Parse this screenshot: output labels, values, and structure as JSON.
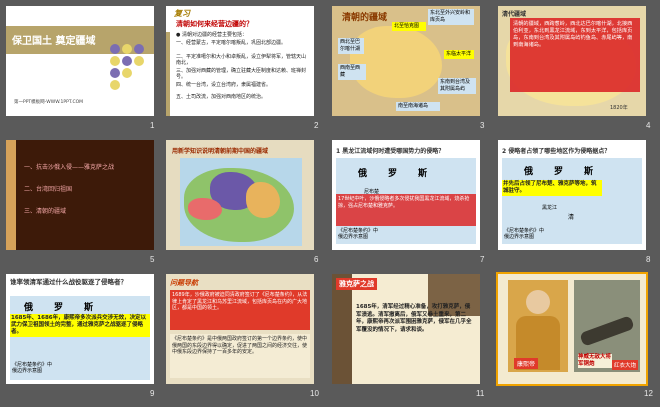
{
  "slides": [
    {
      "num": "1",
      "title": "保卫国土 奠定疆域",
      "footer": "第一PPT模板网-WWW.1PPT.COM"
    },
    {
      "num": "2",
      "tag": "复习",
      "title": "清朝如何来经营边疆的？",
      "lines": [
        "● 清朝对边疆的经营主要包括：",
        "一、经营蒙古，平定喀尔喀叛乱，巩固北部边疆。",
        "二、平定准噶尔和大小和卓叛乱，设立伊犁将军，管辖天山南北，",
        "三、加强对西藏的管理，确立驻藏大臣制度和达赖、班禅封号。",
        "四、统一台湾，设立台湾府，隶属福建省。",
        "五、土司改流，加强对西南地区的统治。"
      ]
    },
    {
      "num": "3",
      "title": "清朝的疆域",
      "labels": [
        "东北至外兴安岭和库页岛",
        "北至恰克图",
        "西北至巴尔喀什湖",
        "西南至西藏",
        "东临太平洋",
        "东南到台湾及其附属岛屿",
        "南至南海诸岛"
      ]
    },
    {
      "num": "4",
      "title": "清代疆域",
      "text": "清朝的疆域，西跨葱岭，西北达巴尔喀什湖，北接西伯利亚，东北到黑龙江流域，东到太平洋，包括库页岛，东南到台湾及其附属岛屿钓鱼岛、赤尾屿等，南到南海诸岛。",
      "caption": "1820年"
    },
    {
      "num": "5",
      "items": [
        "一、抗击沙俄入侵——雅克萨之战",
        "二、台湾回归祖国",
        "三、清朝的疆域"
      ]
    },
    {
      "num": "6",
      "title": "用新学知识说明清朝前期中国的疆域"
    },
    {
      "num": "7",
      "title": "1 黑龙江流域何时遭受哪国势力的侵略？",
      "map": [
        "俄",
        "罗",
        "斯",
        "尼布楚"
      ],
      "text": "17世纪中叶，沙俄侵略者多次侵扰我国黑龙江流域，烧杀抢掠，强占尼布楚和雅克萨。",
      "caption": "《尼布楚条约》中俄边界示意图"
    },
    {
      "num": "8",
      "title": "2 侵略者占领了哪些地区作为侵略据点？",
      "map": [
        "俄",
        "罗",
        "斯",
        "黑龙江",
        "清"
      ],
      "text": "并先后占领了尼布楚、雅克萨等地，筑城驻守。",
      "caption": "《尼布楚条约》中俄边界示意图"
    },
    {
      "num": "9",
      "title": "谁率领清军通过什么战役驱逐了侵略者？",
      "map": [
        "俄",
        "罗",
        "斯"
      ],
      "text": "1685年、1686年，康熙帝多次派兵交涉无效，决定以武力保卫祖国领土的完整，通过雅克萨之战驱逐了侵略者。",
      "caption": "《尼布楚条约》中俄边界示意图"
    },
    {
      "num": "10",
      "tag": "问题导航",
      "text1": "1689年，沙俄政府被迫同清政府签订了《尼布楚条约》，从法律上肯定了黑龙江和乌苏里江流域，包括库页岛在内的广大地区，都是中国的领土。",
      "text2": "《尼布楚条约》是中俄两国政府签订的第一个边界条约，使中俄两国的东段边界得以确定，促进了两国之间的经济交往，使中俄东段边界保持了一百多年的安定。"
    },
    {
      "num": "11",
      "tag": "雅克萨之战",
      "text": "1685年，清军经过精心准备，攻打雅克萨，俄军溃逃。清军撤离后，俄军又卷土重来，第二年，康熙帝再次派军围困雅克萨，俄军在几乎全军覆没的情况下，请求和谈。"
    },
    {
      "num": "12",
      "labels": [
        "康熙帝",
        "神威无敌大将军铜炮",
        "红衣大炮"
      ]
    }
  ],
  "colors": {
    "title_red": "#c00000",
    "accent_orange": "#f0a300",
    "panel_blue": "#c8dff0"
  }
}
